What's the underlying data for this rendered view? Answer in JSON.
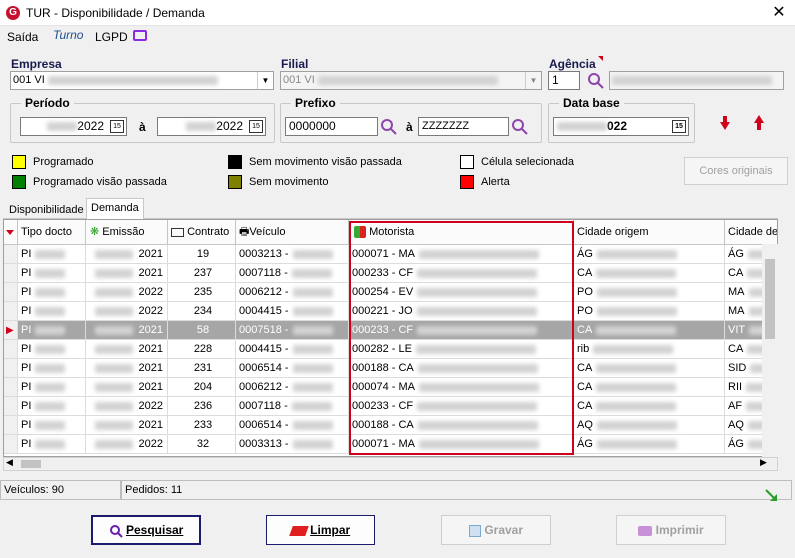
{
  "window": {
    "title": "TUR - Disponibilidade / Demanda",
    "close": "✕"
  },
  "menu": {
    "saida": "Saída",
    "turno": "Turno",
    "lgpd": "LGPD"
  },
  "empresa": {
    "label": "Empresa",
    "value": "001 VI"
  },
  "filial": {
    "label": "Filial",
    "value": "001 VI"
  },
  "agencia": {
    "label": "Agência",
    "value": "1"
  },
  "periodo": {
    "label": "Período",
    "from": "2022",
    "a": "à",
    "to": "2022"
  },
  "prefixo": {
    "label": "Prefixo",
    "from": "0000000",
    "a": "à",
    "to": "ZZZZZZZ"
  },
  "database": {
    "label": "Data base",
    "value": "022"
  },
  "legend": [
    {
      "label": "Programado",
      "color": "#ffff00"
    },
    {
      "label": "Programado visão passada",
      "color": "#008000"
    },
    {
      "label": "Sem movimento visão passada",
      "color": "#000000"
    },
    {
      "label": "Sem movimento",
      "color": "#808000"
    },
    {
      "label": "Célula selecionada",
      "color": "#ffffff"
    },
    {
      "label": "Alerta",
      "color": "#ff0000"
    }
  ],
  "cores_originais": "Cores originais",
  "tabs": {
    "disponibilidade": "Disponibilidade",
    "demanda": "Demanda"
  },
  "grid": {
    "columns": [
      "Tipo docto",
      "Emissão",
      "Contrato",
      "Veículo",
      "Motorista",
      "Cidade origem",
      "Cidade de"
    ],
    "rows": [
      {
        "tipo": "PI",
        "ano": "2021",
        "contrato": "19",
        "veiculo": "0003213 -",
        "motorista": "000071 - MA",
        "origem": "ÁG",
        "destino": "ÁG",
        "selected": false
      },
      {
        "tipo": "PI",
        "ano": "2021",
        "contrato": "237",
        "veiculo": "0007118 -",
        "motorista": "000233 - CF",
        "origem": "CA",
        "destino": "CA",
        "selected": false
      },
      {
        "tipo": "PI",
        "ano": "2022",
        "contrato": "235",
        "veiculo": "0006212 -",
        "motorista": "000254 - EV",
        "origem": "PO",
        "destino": "MA",
        "selected": false
      },
      {
        "tipo": "PI",
        "ano": "2022",
        "contrato": "234",
        "veiculo": "0004415 -",
        "motorista": "000221 - JO",
        "origem": "PO",
        "destino": "MA",
        "selected": false
      },
      {
        "tipo": "PI",
        "ano": "2021",
        "contrato": "58",
        "veiculo": "0007518 -",
        "motorista": "000233 - CF",
        "origem": "CA",
        "destino": "VIT",
        "selected": true
      },
      {
        "tipo": "PI",
        "ano": "2021",
        "contrato": "228",
        "veiculo": "0004415 -",
        "motorista": "000282 - LE",
        "origem": "rib",
        "destino": "CA",
        "selected": false
      },
      {
        "tipo": "PI",
        "ano": "2021",
        "contrato": "231",
        "veiculo": "0006514 -",
        "motorista": "000188 - CA",
        "origem": "CA",
        "destino": "SID",
        "selected": false
      },
      {
        "tipo": "PI",
        "ano": "2021",
        "contrato": "204",
        "veiculo": "0006212 -",
        "motorista": "000074 - MA",
        "origem": "CA",
        "destino": "RII",
        "selected": false
      },
      {
        "tipo": "PI",
        "ano": "2022",
        "contrato": "236",
        "veiculo": "0007118 -",
        "motorista": "000233 - CF",
        "origem": "CA",
        "destino": "AF",
        "selected": false
      },
      {
        "tipo": "PI",
        "ano": "2021",
        "contrato": "233",
        "veiculo": "0006514 -",
        "motorista": "000188 - CA",
        "origem": "AQ",
        "destino": "AQ",
        "selected": false
      },
      {
        "tipo": "PI",
        "ano": "2022",
        "contrato": "32",
        "veiculo": "0003313 -",
        "motorista": "000071 - MA",
        "origem": "ÁG",
        "destino": "ÁG",
        "selected": false
      }
    ]
  },
  "status": {
    "veiculos": "Veículos: 90",
    "pedidos": "Pedidos: 11"
  },
  "buttons": {
    "pesquisar": "Pesquisar",
    "limpar": "Limpar",
    "gravar": "Gravar",
    "imprimir": "Imprimir"
  },
  "colors": {
    "highlight": "#d0021b",
    "selected_row": "#a6a6a6",
    "primary_border": "#1a1a6e"
  }
}
